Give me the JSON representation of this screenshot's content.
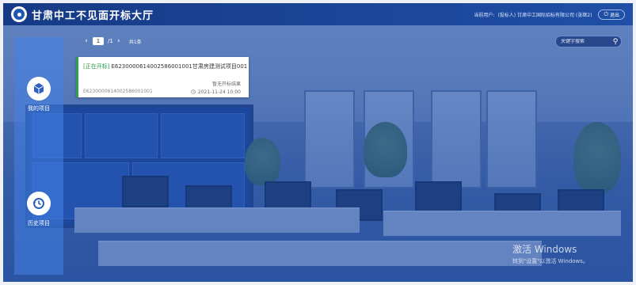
{
  "header": {
    "title": "甘肃中工不见面开标大厅",
    "user_label": "当前用户:",
    "user_name": "(投标人) 甘肃中工国际招标有限公司 (张继2)",
    "exit_label": "退出"
  },
  "sidebar": {
    "items": [
      {
        "label": "我的项目",
        "icon": "cube-icon",
        "active": true
      },
      {
        "label": "历史项目",
        "icon": "history-icon",
        "active": false
      }
    ]
  },
  "pager": {
    "current": "1",
    "separator": "/1",
    "total": "共1条"
  },
  "search": {
    "placeholder": "关键字搜索"
  },
  "projects": [
    {
      "status": "[正在开标]",
      "title": "E6230000614002586001001甘肃房建测试项目001",
      "note": "暂无开标结果",
      "code": "E6230000614002586001001",
      "time": "2021-11-24 10:00"
    }
  ],
  "watermark": {
    "line1": "激活 Windows",
    "line2": "转到\"设置\"以激活 Windows。"
  },
  "colors": {
    "header_bg": "#1f4fa6",
    "overlay": "#1e4eaa",
    "status_green": "#2aa04a"
  }
}
